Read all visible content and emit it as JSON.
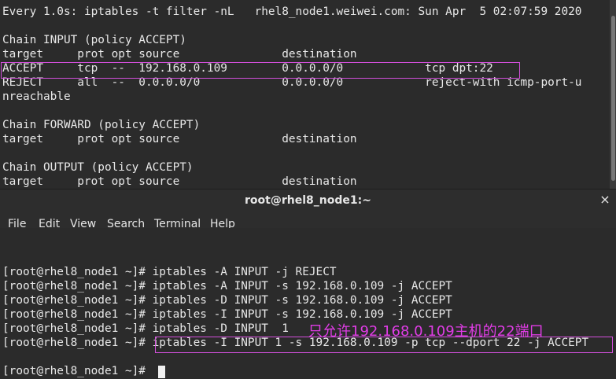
{
  "watch_pane": {
    "header": "Every 1.0s: iptables -t filter -nL   rhel8_node1.weiwei.com: Sun Apr  5 02:07:59 2020",
    "lines": [
      "",
      "Chain INPUT (policy ACCEPT)",
      "target     prot opt source               destination",
      "ACCEPT     tcp  --  192.168.0.109        0.0.0.0/0            tcp dpt:22",
      "REJECT     all  --  0.0.0.0/0            0.0.0.0/0            reject-with icmp-port-u",
      "nreachable",
      "",
      "Chain FORWARD (policy ACCEPT)",
      "target     prot opt source               destination",
      "",
      "Chain OUTPUT (policy ACCEPT)",
      "target     prot opt source               destination"
    ]
  },
  "window": {
    "title": "root@rhel8_node1:~",
    "close_icon": "×"
  },
  "menu": {
    "file": "File",
    "edit": "Edit",
    "view": "View",
    "search": "Search",
    "terminal": "Terminal",
    "help": "Help"
  },
  "shell": {
    "lines": [
      "",
      "",
      "[root@rhel8_node1 ~]# iptables -A INPUT -j REJECT",
      "[root@rhel8_node1 ~]# iptables -A INPUT -s 192.168.0.109 -j ACCEPT",
      "[root@rhel8_node1 ~]# iptables -D INPUT -s 192.168.0.109 -j ACCEPT",
      "[root@rhel8_node1 ~]# iptables -I INPUT -s 192.168.0.109 -j ACCEPT",
      "[root@rhel8_node1 ~]# iptables -D INPUT  1",
      "[root@rhel8_node1 ~]# iptables -I INPUT 1 -s 192.168.0.109 -p tcp --dport 22 -j ACCEPT",
      "",
      "[root@rhel8_node1 ~]# "
    ],
    "annotation": "只允许192.168.0.109主机的22端口"
  },
  "colors": {
    "background": "#2b2b2b",
    "text": "#e8e8e8",
    "highlight": "#d34fdc",
    "annotation": "#e03ce6"
  }
}
